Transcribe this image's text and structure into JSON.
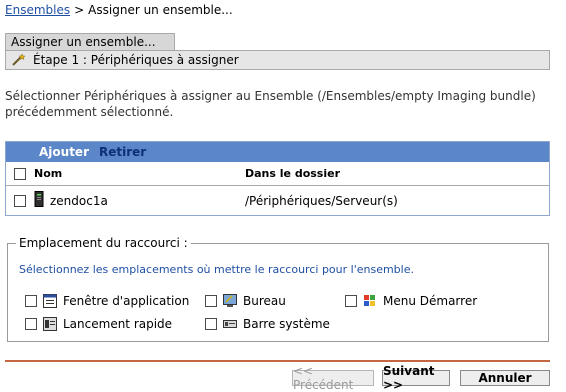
{
  "breadcrumb": {
    "link": "Ensembles",
    "separator": ">",
    "current": "Assigner un ensemble..."
  },
  "wizard": {
    "title": "Assigner un ensemble...",
    "step_label": "Étape 1 : Périphériques à assigner"
  },
  "instructions": "Sélectionner Périphériques à assigner au Ensemble (/Ensembles/empty Imaging bundle) précédemment sélectionné.",
  "table": {
    "toolbar": {
      "add": "Ajouter",
      "remove": "Retirer"
    },
    "headers": {
      "name": "Nom",
      "folder": "Dans le dossier"
    },
    "rows": [
      {
        "name": "zendoc1a",
        "folder": "/Périphériques/Serveur(s)",
        "icon": "server-icon"
      }
    ]
  },
  "shortcut": {
    "legend": "Emplacement du raccourci :",
    "description": "Sélectionnez les emplacements où mettre le raccourci pour l'ensemble.",
    "options": [
      {
        "label": "Fenêtre d'application",
        "icon": "app-window-icon"
      },
      {
        "label": "Bureau",
        "icon": "desktop-icon"
      },
      {
        "label": "Menu Démarrer",
        "icon": "start-menu-icon"
      },
      {
        "label": "Lancement rapide",
        "icon": "quick-launch-icon"
      },
      {
        "label": "Barre système",
        "icon": "system-tray-icon"
      }
    ]
  },
  "buttons": {
    "previous": "<< Précédent",
    "next": "Suivant >>",
    "cancel": "Annuler"
  },
  "colors": {
    "link": "#1f4fa3",
    "table_toolbar": "#5b86c8",
    "footer_line": "#c2673f"
  }
}
